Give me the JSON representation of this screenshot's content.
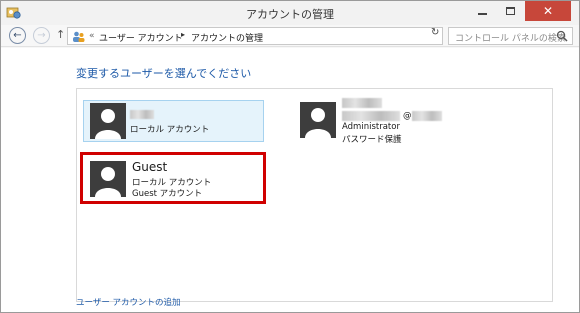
{
  "window": {
    "title": "アカウントの管理",
    "close_glyph": "✕"
  },
  "navbar": {
    "back_glyph": "←",
    "forward_glyph": "→",
    "up_glyph": "↑",
    "crumb_separator": "«",
    "breadcrumb": [
      "ユーザー アカウント",
      "アカウントの管理"
    ],
    "crumb_arrow": "▸",
    "dropdown_glyph": "⌄",
    "refresh_glyph": "↻",
    "search_placeholder": "コントロール パネルの検索"
  },
  "content": {
    "heading": "変更するユーザーを選んでください",
    "accounts": [
      {
        "name": "",
        "type": "ローカル アカウント",
        "extra": "",
        "state": "selected",
        "name_blurred": true
      },
      {
        "name": "",
        "email_at": "@",
        "type": "Administrator",
        "extra": "パスワード保護",
        "name_blurred": true
      },
      {
        "name": "Guest",
        "type": "ローカル アカウント",
        "extra": "Guest アカウント",
        "highlighted": true
      }
    ],
    "add_account_link": "ユーザー アカウントの追加"
  },
  "colors": {
    "accent": "#1e5aa8",
    "highlight_border": "#d00000",
    "close_button": "#c7473a",
    "selected_tile": "#e5f3fb"
  }
}
